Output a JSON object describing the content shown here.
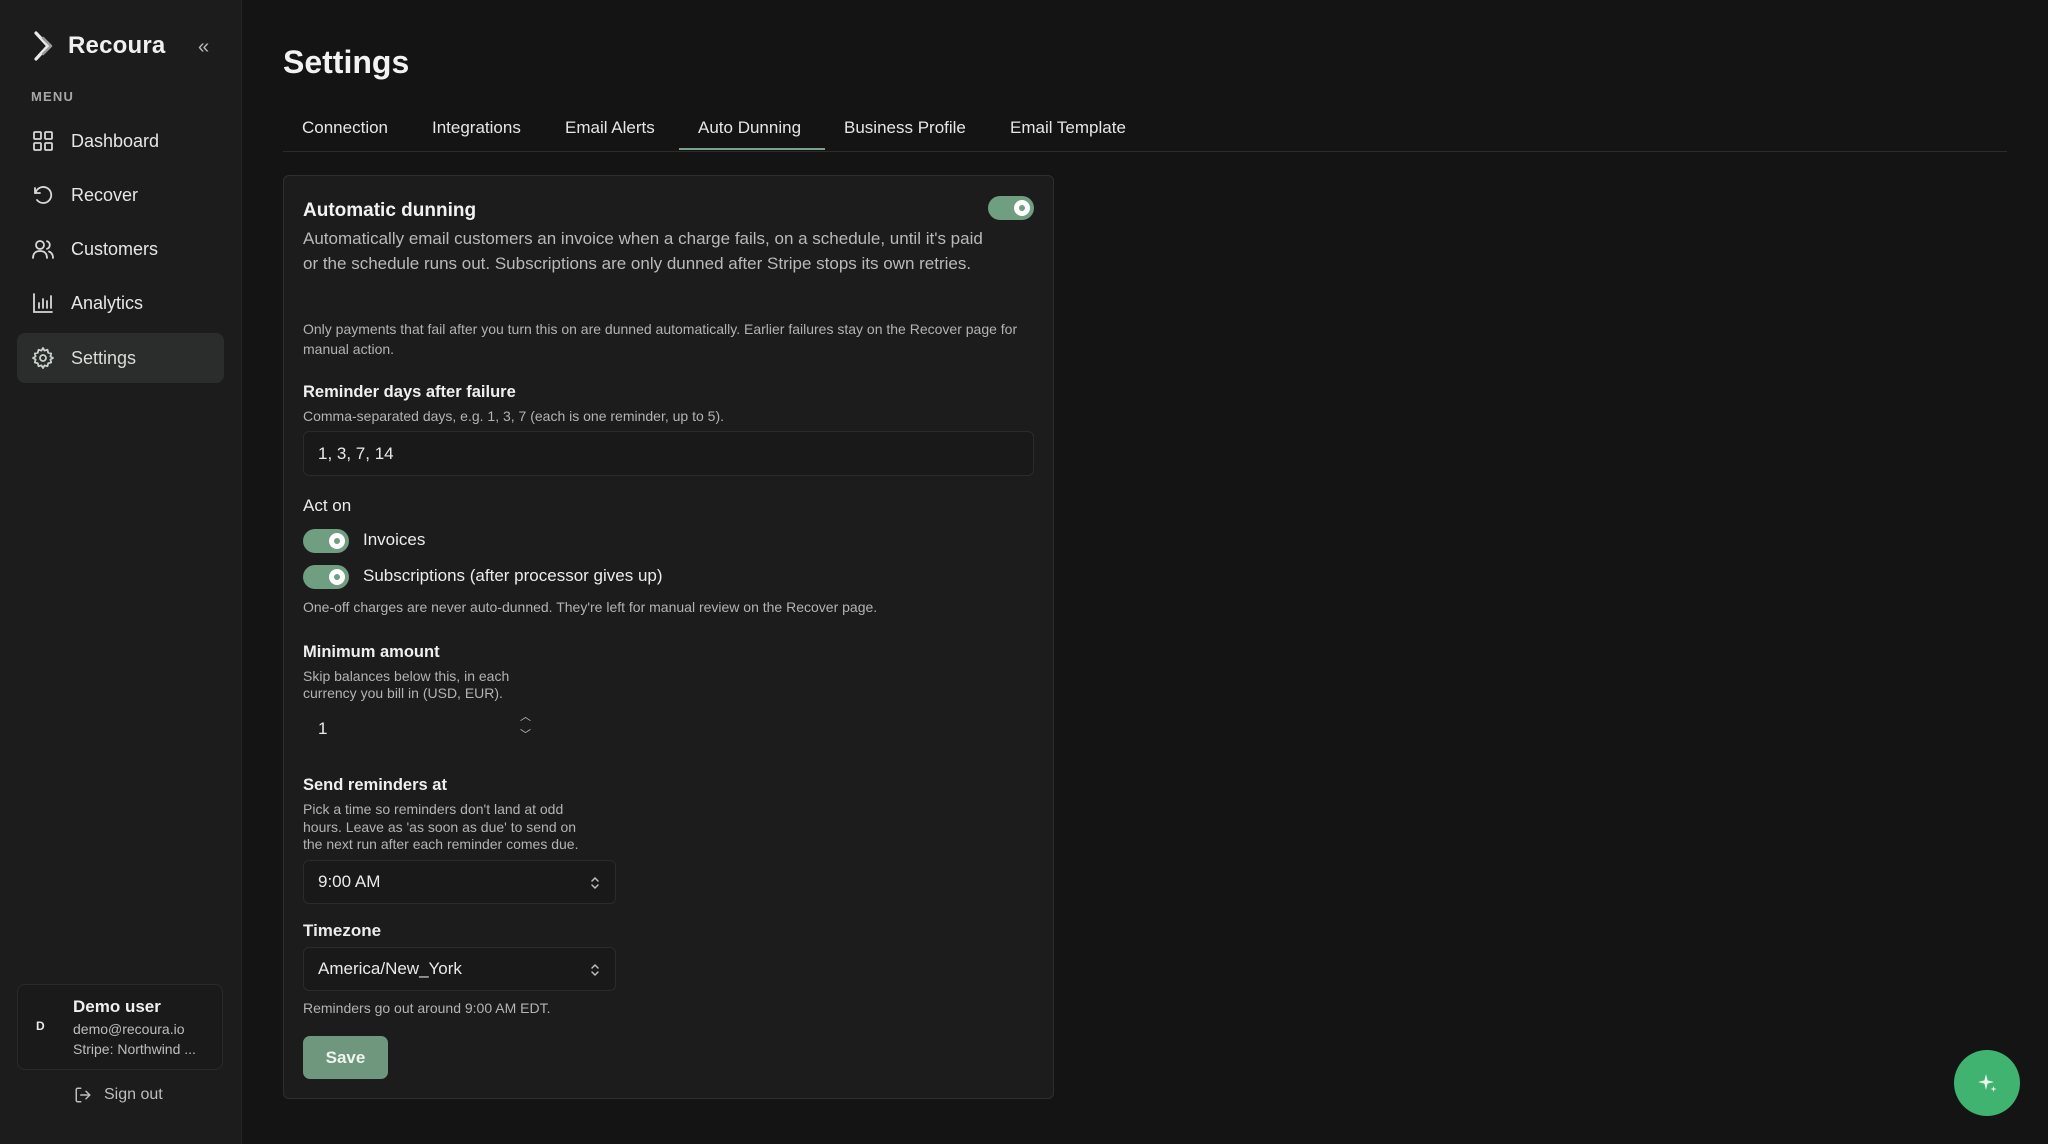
{
  "app": {
    "name": "Recoura",
    "collapse_glyph": "«"
  },
  "sidebar": {
    "menu_label": "MENU",
    "items": [
      {
        "label": "Dashboard",
        "icon": "grid-icon"
      },
      {
        "label": "Recover",
        "icon": "rotate-ccw-icon"
      },
      {
        "label": "Customers",
        "icon": "users-icon"
      },
      {
        "label": "Analytics",
        "icon": "bar-chart-icon"
      },
      {
        "label": "Settings",
        "icon": "gear-icon",
        "active": true
      }
    ],
    "user": {
      "initial": "D",
      "name": "Demo user",
      "email": "demo@recoura.io",
      "stripe": "Stripe: Northwind ..."
    },
    "sign_out": "Sign out"
  },
  "page": {
    "title": "Settings"
  },
  "tabs": [
    {
      "label": "Connection"
    },
    {
      "label": "Integrations"
    },
    {
      "label": "Email Alerts"
    },
    {
      "label": "Auto Dunning",
      "active": true
    },
    {
      "label": "Business Profile"
    },
    {
      "label": "Email Template"
    }
  ],
  "dunning": {
    "title": "Automatic dunning",
    "enabled": true,
    "description": "Automatically email customers an invoice when a charge fails, on a schedule, until it's paid or the schedule runs out. Subscriptions are only dunned after Stripe stops its own retries.",
    "note": "Only payments that fail after you turn this on are dunned automatically. Earlier failures stay on the Recover page for manual action.",
    "reminder_days": {
      "label": "Reminder days after failure",
      "help": "Comma-separated days, e.g. 1, 3, 7 (each is one reminder, up to 5).",
      "value": "1, 3, 7, 14"
    },
    "act_on": {
      "label": "Act on",
      "invoices": {
        "label": "Invoices",
        "enabled": true
      },
      "subscriptions": {
        "label": "Subscriptions (after processor gives up)",
        "enabled": true
      },
      "help": "One-off charges are never auto-dunned. They're left for manual review on the Recover page."
    },
    "minimum_amount": {
      "label": "Minimum amount",
      "help_line1": "Skip balances below this, in each",
      "help_line2": "currency you bill in (USD, EUR).",
      "value": "1"
    },
    "send_at": {
      "label": "Send reminders at",
      "help_line1": "Pick a time so reminders don't land at odd",
      "help_line2": "hours. Leave as 'as soon as due' to send on",
      "help_line3": "the next run after each reminder comes due.",
      "value": "9:00 AM"
    },
    "timezone": {
      "label": "Timezone",
      "value": "America/New_York",
      "help": "Reminders go out around 9:00 AM EDT."
    },
    "save_label": "Save"
  },
  "colors": {
    "accent": "#6f9e80",
    "fab": "#3fb36f",
    "background": "#141414",
    "sidebar": "#1c1c1c"
  }
}
